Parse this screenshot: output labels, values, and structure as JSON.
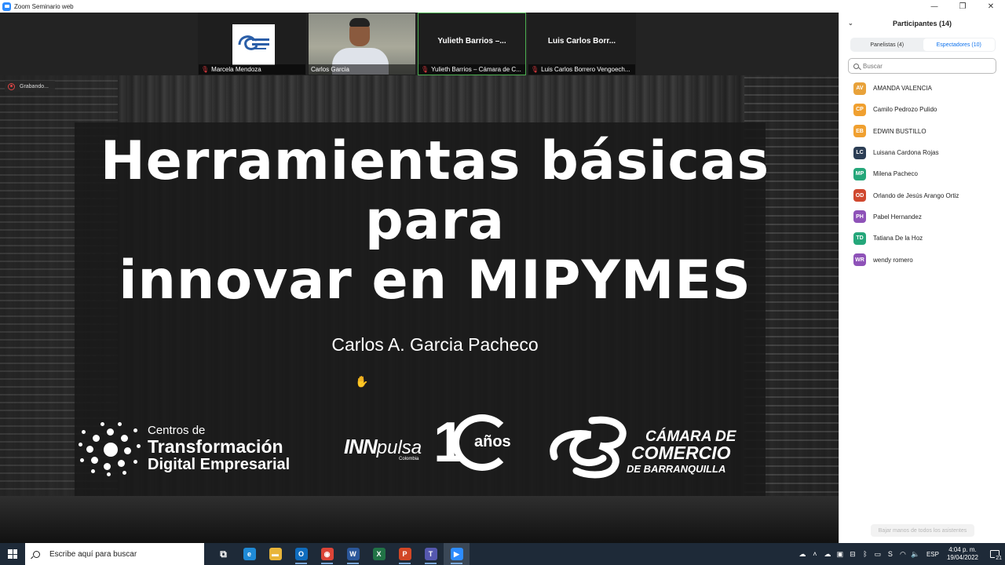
{
  "window": {
    "title": "Zoom Seminario web",
    "minimize_glyph": "—",
    "maximize_glyph": "❐",
    "close_glyph": "✕"
  },
  "recording": {
    "label": "Grabando..."
  },
  "thumbnails": [
    {
      "name": "Marcela Mendoza",
      "big_name": "",
      "muted": true,
      "kind": "logo"
    },
    {
      "name": "Carlos Garcia",
      "big_name": "",
      "muted": false,
      "kind": "camera"
    },
    {
      "name": "Yulieth Barrios – Cámara de C...",
      "big_name": "Yulieth  Barrios –...",
      "muted": true,
      "kind": "name"
    },
    {
      "name": "Luis Carlos Borrero Vengoech...",
      "big_name": "Luis Carlos Borr...",
      "muted": true,
      "kind": "name"
    }
  ],
  "slide": {
    "title_line1": "Herramientas básicas",
    "title_line2": "para",
    "title_line3": "innovar en MIPYMES",
    "author": "Carlos A. Garcia Pacheco",
    "logo_ctde": {
      "l1": "Centros de",
      "l2": "Transformación",
      "l3": "Digital Empresarial"
    },
    "logo_innpulsa": {
      "inn": "INN",
      "pulsa": "pulsa",
      "country": "Colombia"
    },
    "logo_10": {
      "one": "1",
      "anos": "años"
    },
    "logo_camara": {
      "l1": "CÁMARA DE",
      "l2": "COMERCIO",
      "l3": "DE BARRANQUILLA"
    }
  },
  "participants_panel": {
    "title": "Participantes (14)",
    "tabs": [
      {
        "label": "Panelistas (4)",
        "active": false
      },
      {
        "label": "Espectadores (10)",
        "active": true
      }
    ],
    "search_placeholder": "Buscar",
    "attendees": [
      {
        "initials": "AV",
        "name": "AMANDA VALENCIA",
        "color": "#e8a23a"
      },
      {
        "initials": "CP",
        "name": "Camilo Pedrozo Pulido",
        "color": "#f0a030"
      },
      {
        "initials": "EB",
        "name": "EDWIN BUSTILLO",
        "color": "#f0a030"
      },
      {
        "initials": "LC",
        "name": "Luisana Cardona Rojas",
        "color": "#2c3e55"
      },
      {
        "initials": "MP",
        "name": "Milena Pacheco",
        "color": "#25a77a"
      },
      {
        "initials": "OD",
        "name": "Orlando de Jesús Arango Ortiz",
        "color": "#d0482f"
      },
      {
        "initials": "PH",
        "name": "Pabel Hernandez",
        "color": "#8e52b8"
      },
      {
        "initials": "TD",
        "name": "Tatiana De la Hoz",
        "color": "#25a77a"
      },
      {
        "initials": "WR",
        "name": "wendy romero",
        "color": "#8e52b8"
      }
    ],
    "lower_hands_label": "Bajar manos de todos los asistentes"
  },
  "taskbar": {
    "search_placeholder": "Escribe aquí para buscar",
    "apps": [
      {
        "icon": "task-view-icon",
        "glyph": "⧉",
        "color": "transparent",
        "open": false
      },
      {
        "icon": "edge-icon",
        "glyph": "e",
        "color": "#1f8ad6",
        "open": false
      },
      {
        "icon": "file-explorer-icon",
        "glyph": "▬",
        "color": "#e8b53a",
        "open": false
      },
      {
        "icon": "outlook-icon",
        "glyph": "O",
        "color": "#0f6cbd",
        "open": true
      },
      {
        "icon": "chrome-icon",
        "glyph": "◉",
        "color": "#db4437",
        "open": true
      },
      {
        "icon": "word-icon",
        "glyph": "W",
        "color": "#2b579a",
        "open": true
      },
      {
        "icon": "excel-icon",
        "glyph": "X",
        "color": "#217346",
        "open": false
      },
      {
        "icon": "powerpoint-icon",
        "glyph": "P",
        "color": "#d24726",
        "open": true
      },
      {
        "icon": "teams-icon",
        "glyph": "T",
        "color": "#5558af",
        "open": true
      },
      {
        "icon": "zoom-icon",
        "glyph": "▶",
        "color": "#2d8cff",
        "open": true
      }
    ],
    "language": "ESP",
    "time": "4:04 p. m.",
    "date": "19/04/2022",
    "notification_count": "21"
  }
}
